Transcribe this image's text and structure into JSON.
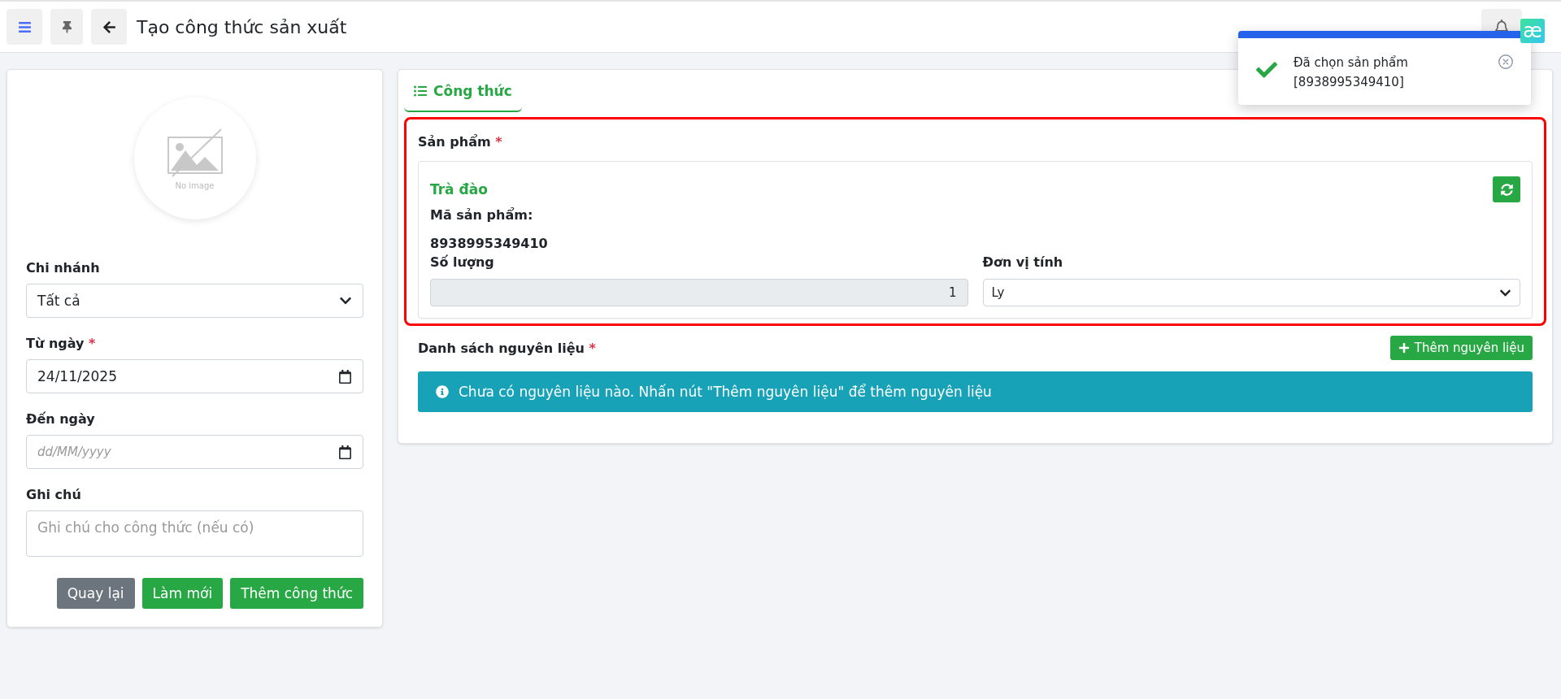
{
  "topbar": {
    "title": "Tạo công thức sản xuất",
    "logo_text": "æ"
  },
  "toast": {
    "message": "Đã chọn sản phẩm",
    "detail": "[8938995349410]"
  },
  "form": {
    "image_caption": "No image",
    "fields": [
      {
        "kind": "select",
        "label": "Chi nhánh",
        "value": "Tất cả"
      },
      {
        "kind": "date",
        "label": "Từ ngày",
        "required_mark": "*",
        "value": "24/11/2025"
      },
      {
        "kind": "date",
        "label": "Đến ngày",
        "placeholder": "dd/MM/yyyy"
      },
      {
        "kind": "textarea",
        "label": "Ghi chú",
        "placeholder": "Ghi chú cho công thức (nếu có)"
      }
    ],
    "buttons": [
      {
        "label": "Quay lại",
        "kind": "secondary"
      },
      {
        "label": "Làm mới",
        "kind": "success"
      },
      {
        "label": "Thêm công thức",
        "kind": "success"
      }
    ]
  },
  "tabs": [
    {
      "label": "Công thức",
      "selected": true
    }
  ],
  "product": {
    "label": "Sản phẩm",
    "required_mark": "*",
    "highlighted": true,
    "name": "Trà đào",
    "code_label": "Mã sản phẩm:",
    "code": "8938995349410",
    "quantity_label": "Số lượng",
    "quantity": "1",
    "unit_label": "Đơn vị tính",
    "unit": "Ly"
  },
  "ingredients": {
    "label": "Danh sách nguyên liệu",
    "required_mark": "*",
    "add_button": "Thêm nguyên liệu",
    "empty_message": "Chưa có nguyên liệu nào. Nhấn nút \"Thêm nguyên liệu\" để thêm nguyên liệu"
  }
}
